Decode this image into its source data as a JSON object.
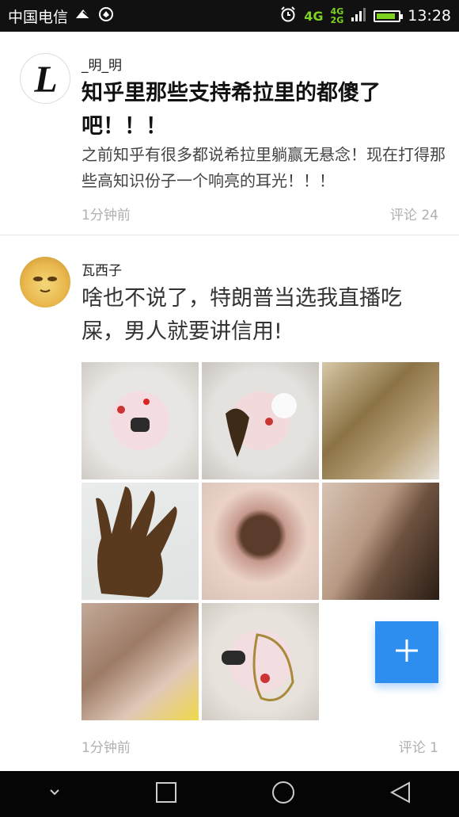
{
  "status_bar": {
    "carrier": "中国电信",
    "network_top": "4G",
    "network_bottom": "2G",
    "network_main": "4G",
    "time": "13:28",
    "battery_level": 0.9,
    "icons": [
      "wifi-signal-icon",
      "shield-icon",
      "alarm-icon",
      "signal-icon",
      "battery-icon"
    ]
  },
  "posts": [
    {
      "author": "_明_明",
      "title": "知乎里那些支持希拉里的都傻了吧！！！",
      "excerpt": "之前知乎有很多都说希拉里躺赢无悬念！现在打得那些高知识份子一个响亮的耳光！！！",
      "time": "1分钟前",
      "comments": "评论 24"
    },
    {
      "author": "瓦西子",
      "title": "啥也不说了，特朗普当选我直播吃屎，男人就要讲信用!",
      "time": "1分钟前",
      "comments": "评论 1",
      "image_count": 8
    }
  ],
  "fab": {
    "icon": "plus-icon"
  },
  "nav_bar": {
    "icons": [
      "back-down-icon",
      "recent-apps-icon",
      "home-icon",
      "back-icon"
    ]
  },
  "colors": {
    "accent": "#2e8ef0",
    "status_bar": "#111111",
    "network": "#7ed321"
  }
}
